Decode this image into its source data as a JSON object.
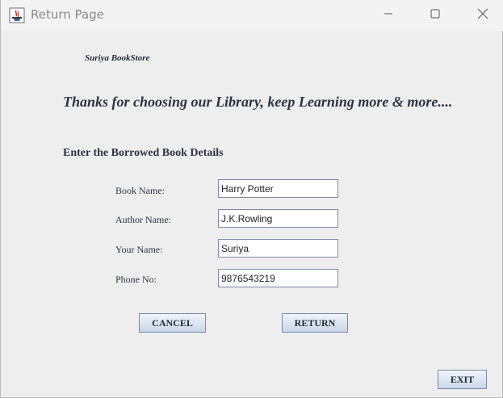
{
  "window": {
    "title": "Return Page",
    "app_icon": "java-cup-icon",
    "controls": {
      "minimize_icon": "minimize-icon",
      "maximize_icon": "maximize-icon",
      "close_icon": "close-icon"
    }
  },
  "header": {
    "store_name": "Suriya BookStore",
    "tagline": "Thanks for choosing our Library, keep Learning more & more...."
  },
  "form": {
    "heading": "Enter the Borrowed Book Details",
    "fields": [
      {
        "label": "Book Name:",
        "value": "Harry Potter"
      },
      {
        "label": "Author Name:",
        "value": "J.K.Rowling"
      },
      {
        "label": "Your Name:",
        "value": "Suriya"
      },
      {
        "label": "Phone No:",
        "value": "9876543219"
      }
    ]
  },
  "buttons": {
    "cancel": "CANCEL",
    "return": "RETURN",
    "exit": "EXIT"
  },
  "colors": {
    "background": "#eeeeee",
    "text": "#2b3445",
    "button_border": "#7a8aa6"
  }
}
